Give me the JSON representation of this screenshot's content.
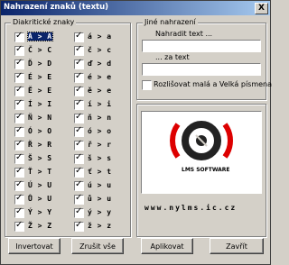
{
  "window": {
    "title": "Nahrazení znaků (textu)",
    "close_label": "X"
  },
  "diacritic_group": {
    "label": "Diakritické znaky"
  },
  "left_column": [
    "Á > A",
    "Č > C",
    "Ď > D",
    "É > E",
    "Ě > E",
    "Í > I",
    "Ň > N",
    "Ó > O",
    "Ř > R",
    "Š > S",
    "Ť > T",
    "Ú > U",
    "Ů > U",
    "Ý > Y",
    "Ž > Z"
  ],
  "right_column": [
    "á > a",
    "č > c",
    "ď > d",
    "é > e",
    "ě > e",
    "í > i",
    "ň > n",
    "ó > o",
    "ř > r",
    "š > s",
    "ť > t",
    "ú > u",
    "ů > u",
    "ý > y",
    "ž > z"
  ],
  "other_group": {
    "label": "Jiné nahrazení",
    "replace_label": "Nahradit text ...",
    "with_label": "... za text",
    "replace_value": "",
    "with_value": "",
    "case_label": "Rozlišovat malá a Velká písmena"
  },
  "logo": {
    "brand": "LMS SOFTWARE",
    "url": "www.nylms.ic.cz"
  },
  "buttons": {
    "invert": "Invertovat",
    "clear_all": "Zrušit vše",
    "apply": "Aplikovat",
    "close": "Zavřít"
  }
}
